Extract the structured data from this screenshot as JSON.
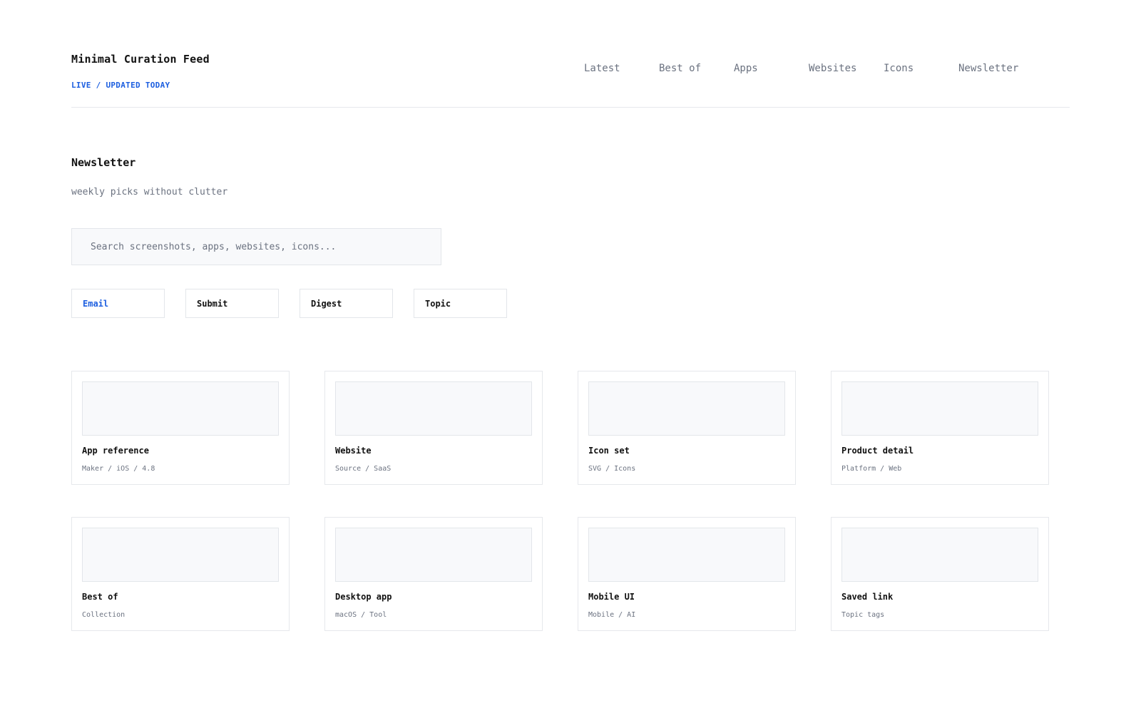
{
  "header": {
    "title": "Minimal Curation Feed",
    "status": "LIVE / UPDATED TODAY",
    "nav": [
      "Latest",
      "Best of",
      "Apps",
      "Websites",
      "Icons",
      "Newsletter"
    ]
  },
  "newsletter": {
    "title": "Newsletter",
    "subtitle": "weekly picks without clutter",
    "search_placeholder": "Search screenshots, apps, websites, icons...",
    "chips": [
      "Email",
      "Submit",
      "Digest",
      "Topic"
    ],
    "active_chip": "Email"
  },
  "cards": [
    {
      "title": "App reference",
      "meta": "Maker / iOS / 4.8"
    },
    {
      "title": "Website",
      "meta": "Source / SaaS"
    },
    {
      "title": "Icon set",
      "meta": "SVG / Icons"
    },
    {
      "title": "Product detail",
      "meta": "Platform / Web"
    },
    {
      "title": "Best of",
      "meta": "Collection"
    },
    {
      "title": "Desktop app",
      "meta": "macOS / Tool"
    },
    {
      "title": "Mobile UI",
      "meta": "Mobile / AI"
    },
    {
      "title": "Saved link",
      "meta": "Topic tags"
    }
  ],
  "colors": {
    "accent": "#1d5fe0",
    "text": "#111111",
    "muted": "#6b7280",
    "border": "#e3e6ea",
    "thumb_bg": "#f8f9fb"
  }
}
